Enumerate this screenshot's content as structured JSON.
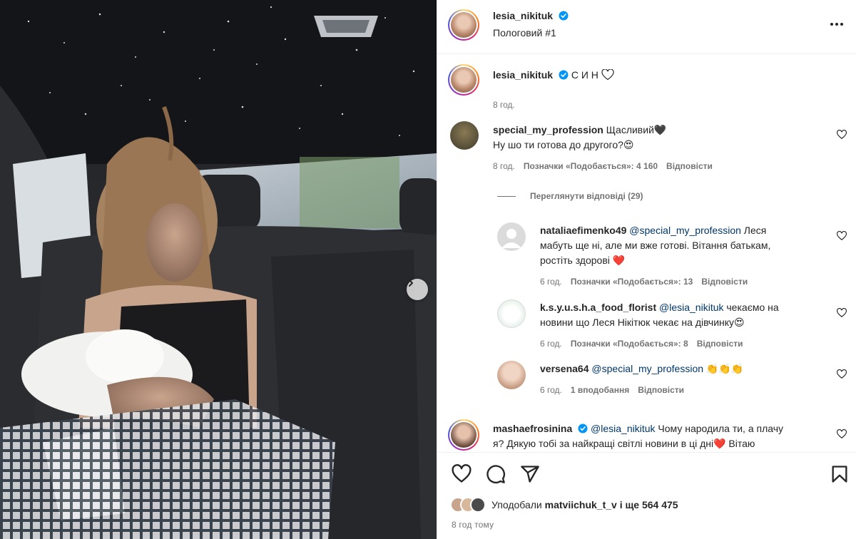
{
  "post": {
    "author": "lesia_nikituk",
    "location": "Пологовий #1",
    "caption_text": "С И Н",
    "caption_time": "8 год.",
    "likes_prefix": "Уподобали",
    "likes_user": "matviichuk_t_v",
    "likes_suffix": "і ще 564 475",
    "posted_ago": "8 год тому"
  },
  "comments": [
    {
      "user": "special_my_profession",
      "text_line1": "Щасливий🖤",
      "text_line2": "Ну шо ти готова до другого?😍",
      "time": "8 год.",
      "likes": "Позначки «Подобається»: 4 160",
      "reply": "Відповісти",
      "view_replies": "Переглянути відповіді (29)"
    },
    {
      "user": "nataliaefimenko49",
      "mention": "@special_my_profession",
      "text_rest1": "Леся",
      "text_line2": "мабуть ще ні, але ми вже готові. Вітання батькам,",
      "text_line3": "ростіть здорові ❤️",
      "time": "6 год.",
      "likes": "Позначки «Подобається»: 13",
      "reply": "Відповісти"
    },
    {
      "user": "k.s.y.u.s.h.a_food_florist",
      "mention": "@lesia_nikituk",
      "text_rest1": "чекаємо на",
      "text_line2": "новини що Леся Нікітюк чекає на дівчинку😍",
      "time": "6 год.",
      "likes": "Позначки «Подобається»: 8",
      "reply": "Відповісти"
    },
    {
      "user": "versena64",
      "mention": "@special_my_profession",
      "text_rest1": "👏👏👏",
      "time": "6 год.",
      "likes": "1 вподобання",
      "reply": "Відповісти"
    },
    {
      "user": "mashaefrosinina",
      "mention": "@lesia_nikituk",
      "text_rest1": "Чому народила ти, а плачу",
      "text_line2": "я? Дякую тобі за найкращі світлі новини в ці дні❤️ Вітаю"
    }
  ],
  "colors": {
    "text": "#262626",
    "secondary": "#737373",
    "mention": "#00376b",
    "verified": "#0095f6",
    "heart_red": "#ed4956"
  },
  "icons": {
    "like": "heart-icon",
    "comment": "comment-icon",
    "share": "send-icon",
    "save": "bookmark-icon",
    "more": "more-icon",
    "next": "chevron-right-icon"
  }
}
